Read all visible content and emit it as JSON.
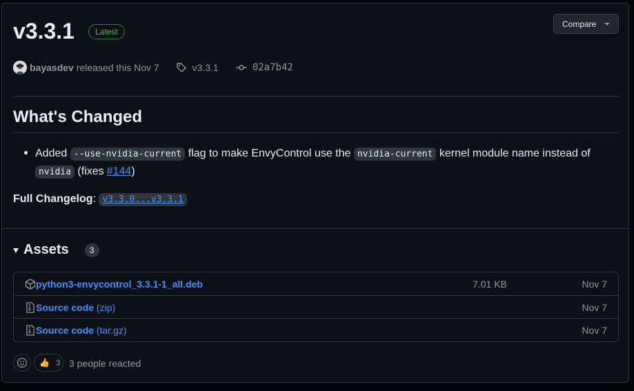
{
  "release": {
    "title": "v3.3.1",
    "latest_badge": "Latest",
    "compare_label": "Compare",
    "author": "bayasdev",
    "released_text": "released this Nov 7",
    "tag": "v3.3.1",
    "commit": "02a7b42"
  },
  "notes": {
    "heading": "What's Changed",
    "bullet": {
      "added": "Added",
      "code1": "--use-nvidia-current",
      "text1": "flag to make EnvyControl use the",
      "code2": "nvidia-current",
      "text2": "kernel module name instead of",
      "code3": "nvidia",
      "fixes_prefix": "(fixes",
      "issue": "#144",
      "fixes_suffix": ")"
    },
    "changelog_label": "Full Changelog",
    "changelog_sep": ":",
    "changelog_link": "v3.3.0...v3.3.1"
  },
  "assets": {
    "heading": "Assets",
    "count": "3",
    "items": [
      {
        "name": "python3-envycontrol_3.3.1-1_all.deb",
        "suffix": "",
        "size": "7.01 KB",
        "date": "Nov 7",
        "icon": "package-icon"
      },
      {
        "name": "Source code",
        "suffix": "(zip)",
        "size": "",
        "date": "Nov 7",
        "icon": "file-zip-icon"
      },
      {
        "name": "Source code",
        "suffix": "(tar.gz)",
        "size": "",
        "date": "Nov 7",
        "icon": "file-zip-icon"
      }
    ]
  },
  "reactions": {
    "thumbs_count": "3",
    "summary": "3 people reacted",
    "thumbs_emoji": "👍"
  },
  "colors": {
    "background": "#0d1117",
    "link": "#4493f8",
    "latest_green": "#3fb950",
    "muted": "#9198a1",
    "border": "#30363d"
  }
}
